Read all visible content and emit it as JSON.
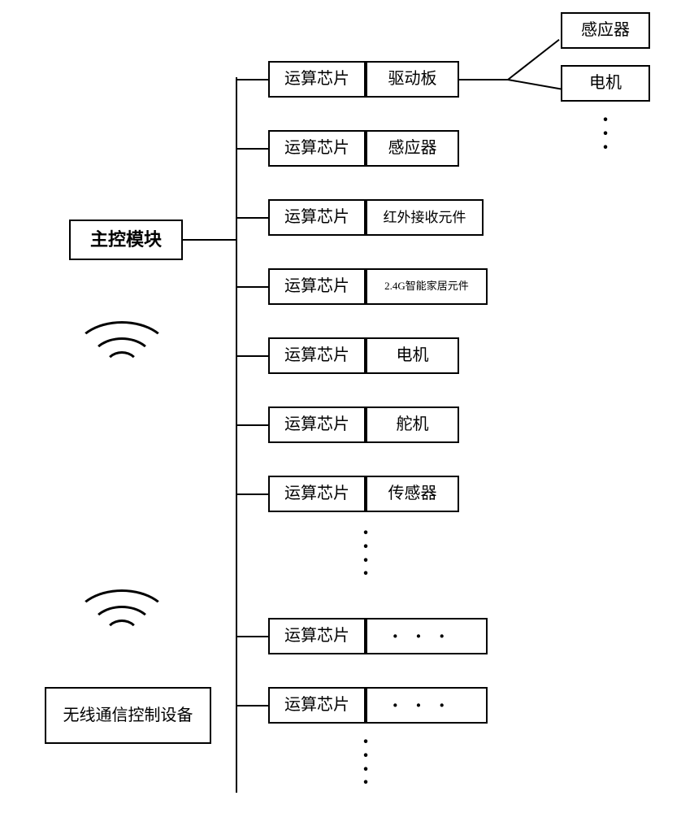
{
  "left": {
    "master": "主控模块",
    "wireless": "无线通信控制设备"
  },
  "modules": [
    {
      "chip": "运算芯片",
      "part": "驱动板"
    },
    {
      "chip": "运算芯片",
      "part": "感应器"
    },
    {
      "chip": "运算芯片",
      "part": "红外接收元件"
    },
    {
      "chip": "运算芯片",
      "part": "2.4G智能家居元件"
    },
    {
      "chip": "运算芯片",
      "part": "电机"
    },
    {
      "chip": "运算芯片",
      "part": "舵机"
    },
    {
      "chip": "运算芯片",
      "part": "传感器"
    },
    {
      "chip": "运算芯片",
      "part": ""
    },
    {
      "chip": "运算芯片",
      "part": ""
    }
  ],
  "right_top": {
    "sensor": "感应器",
    "motor": "电机"
  }
}
